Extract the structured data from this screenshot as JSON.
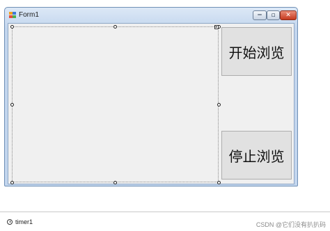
{
  "window": {
    "title": "Form1",
    "minimize_glyph": "−",
    "maximize_glyph": "▫",
    "close_glyph": "✕"
  },
  "buttons": {
    "start_label": "开始浏览",
    "stop_label": "停止浏览"
  },
  "tray": {
    "components": [
      {
        "label": "timer1",
        "icon": "timer-icon"
      }
    ]
  },
  "watermark": "CSDN @它们没有扒扒码"
}
